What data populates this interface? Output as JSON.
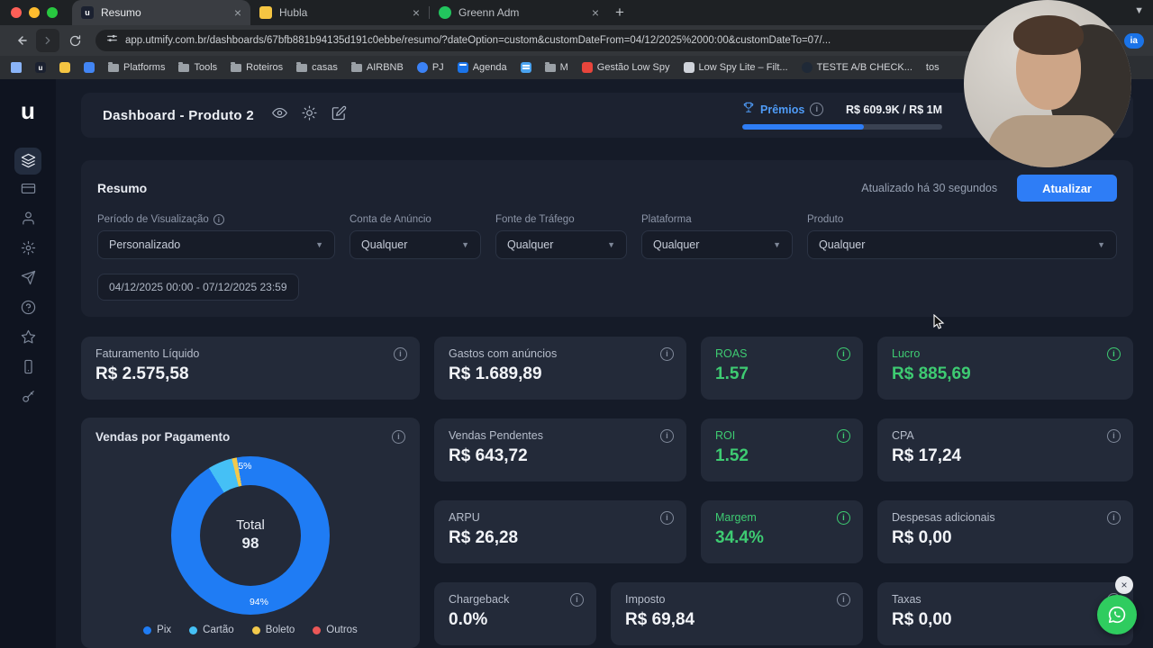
{
  "browser": {
    "tabs": [
      {
        "title": "Resumo",
        "active": true
      },
      {
        "title": "Hubla",
        "active": false
      },
      {
        "title": "Greenn Adm",
        "active": false
      }
    ],
    "url": "app.utmify.com.br/dashboards/67bfb881b94135d191c0ebbe/resumo/?dateOption=custom&customDateFrom=04/12/2025%2000:00&customDateTo=07/...",
    "profile_badge": "ia",
    "bookmarks": [
      {
        "label": "",
        "icon": "apps-grid"
      },
      {
        "label": "",
        "icon": "utmify"
      },
      {
        "label": "",
        "icon": "hubla"
      },
      {
        "label": "",
        "icon": "blue-site"
      },
      {
        "label": "Platforms",
        "icon": "folder"
      },
      {
        "label": "Tools",
        "icon": "folder"
      },
      {
        "label": "Roteiros",
        "icon": "folder"
      },
      {
        "label": "casas",
        "icon": "folder"
      },
      {
        "label": "AIRBNB",
        "icon": "folder"
      },
      {
        "label": "PJ",
        "icon": "blue-dot"
      },
      {
        "label": "Agenda",
        "icon": "calendar"
      },
      {
        "label": "",
        "icon": "blue-list"
      },
      {
        "label": "M",
        "icon": "folder"
      },
      {
        "label": "Gestão Low Spy",
        "icon": "red-site"
      },
      {
        "label": "Low Spy Lite – Filt...",
        "icon": "gray-site"
      },
      {
        "label": "TESTE A/B CHECK...",
        "icon": "dark-site"
      },
      {
        "label": "tos",
        "icon": "none"
      }
    ]
  },
  "header": {
    "title": "Dashboard - Produto 2",
    "premios": {
      "label": "Prêmios",
      "current": "R$ 609.9K",
      "separator": "/",
      "target": "R$ 1M",
      "progress_pct": 61
    }
  },
  "resumo": {
    "title": "Resumo",
    "updated": "Atualizado há 30 segundos",
    "refresh": "Atualizar",
    "filters": [
      {
        "label": "Período de Visualização",
        "value": "Personalizado"
      },
      {
        "label": "Conta de Anúncio",
        "value": "Qualquer"
      },
      {
        "label": "Fonte de Tráfego",
        "value": "Qualquer"
      },
      {
        "label": "Plataforma",
        "value": "Qualquer"
      },
      {
        "label": "Produto",
        "value": "Qualquer"
      }
    ],
    "date_range": "04/12/2025 00:00 - 07/12/2025 23:59"
  },
  "metrics": {
    "faturamento": {
      "label": "Faturamento Líquido",
      "value": "R$ 2.575,58"
    },
    "gastos": {
      "label": "Gastos com anúncios",
      "value": "R$ 1.689,89"
    },
    "roas": {
      "label": "ROAS",
      "value": "1.57"
    },
    "lucro": {
      "label": "Lucro",
      "value": "R$ 885,69"
    },
    "vendas_pendentes": {
      "label": "Vendas Pendentes",
      "value": "R$ 643,72"
    },
    "roi": {
      "label": "ROI",
      "value": "1.52"
    },
    "cpa": {
      "label": "CPA",
      "value": "R$ 17,24"
    },
    "arpu": {
      "label": "ARPU",
      "value": "R$ 26,28"
    },
    "margem": {
      "label": "Margem",
      "value": "34.4%"
    },
    "despesas": {
      "label": "Despesas adicionais",
      "value": "R$ 0,00"
    },
    "chargeback": {
      "label": "Chargeback",
      "value": "0.0%"
    },
    "imposto": {
      "label": "Imposto",
      "value": "R$ 69,84"
    },
    "taxas": {
      "label": "Taxas",
      "value": "R$ 0,00"
    }
  },
  "chart_data": {
    "type": "pie",
    "title": "Vendas por Pagamento",
    "labels": [
      "Pix",
      "Cartão",
      "Boleto",
      "Outros"
    ],
    "values": [
      94,
      5,
      1,
      0
    ],
    "unit": "%",
    "colors": [
      "#1f7cf4",
      "#45c0f5",
      "#f2c94c",
      "#eb5757"
    ],
    "center_label": "Total",
    "center_value": "98",
    "callouts": [
      {
        "text": "5%"
      },
      {
        "text": "94%"
      }
    ],
    "legend_position": "bottom"
  },
  "colors": {
    "accent_blue": "#2e7df6",
    "accent_green": "#3ecb72"
  }
}
